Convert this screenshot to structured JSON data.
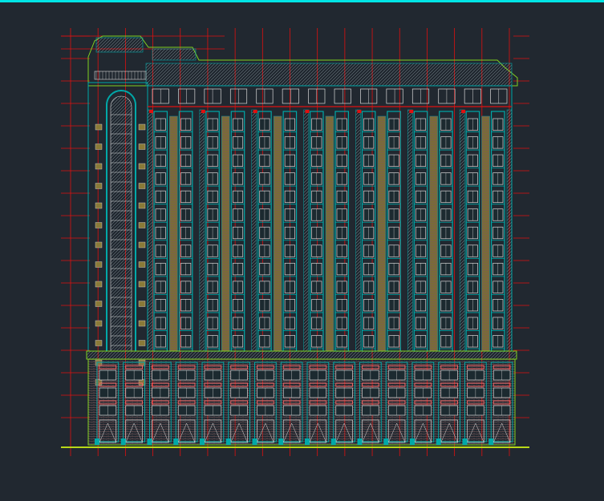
{
  "viewport": {
    "background": "#212830",
    "top_bar_color": "#00e5e5"
  },
  "drawing": {
    "type": "cad-building-elevation",
    "tower_floors": 13,
    "base_floors": 3,
    "bays": 14,
    "grid_lines": 17,
    "colors": {
      "grid": "#e01010",
      "outline": "#80d020",
      "structure": "#00a8a8",
      "hatch": "#8a9aa0",
      "window": "#d8d8d8",
      "column_infill": "#8a7a38",
      "base_accent": "#ff6a6a",
      "ground": "#b8d818"
    }
  }
}
